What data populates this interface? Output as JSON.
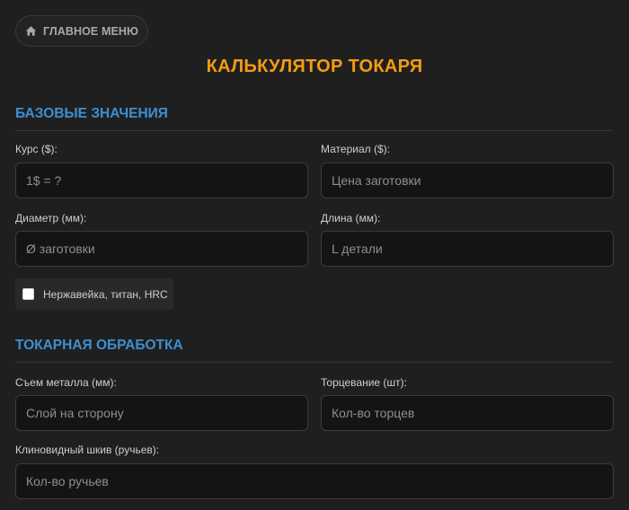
{
  "nav": {
    "home_label": "ГЛАВНОЕ МЕНЮ",
    "home_icon": "home-icon"
  },
  "title": "КАЛЬКУЛЯТОР ТОКАРЯ",
  "colors": {
    "accent_orange": "#f39c12",
    "section_blue": "#3e8fd0",
    "background": "#1f1f1f",
    "input_bg": "#141414"
  },
  "base_section": {
    "title": "БАЗОВЫЕ ЗНАЧЕНИЯ",
    "rate_label": "Курс ($):",
    "rate_placeholder": "1$ = ?",
    "material_label": "Материал ($):",
    "material_placeholder": "Цена заготовки",
    "diameter_label": "Диаметр (мм):",
    "diameter_placeholder": "Ø заготовки",
    "length_label": "Длина (мм):",
    "length_placeholder": "L детали",
    "hard_material_label": "Нержавейка, титан, HRC",
    "hard_material_checked": false
  },
  "turning_section": {
    "title": "ТОКАРНАЯ ОБРАБОТКА",
    "removal_label": "Съем металла (мм):",
    "removal_placeholder": "Слой на сторону",
    "facing_label": "Торцевание (шт):",
    "facing_placeholder": "Кол-во торцев",
    "pulley_label": "Клиновидный шкив (ручьев):",
    "pulley_placeholder": "Кол-во ручьев"
  }
}
